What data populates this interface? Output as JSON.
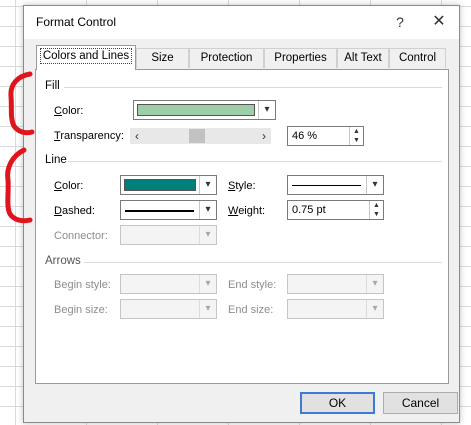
{
  "window": {
    "title": "Format Control",
    "help_glyph": "?",
    "close_glyph": "✕"
  },
  "tabs": [
    {
      "label": "Colors and Lines",
      "active": true
    },
    {
      "label": "Size",
      "active": false
    },
    {
      "label": "Protection",
      "active": false
    },
    {
      "label": "Properties",
      "active": false
    },
    {
      "label": "Alt Text",
      "active": false
    },
    {
      "label": "Control",
      "active": false
    }
  ],
  "fill": {
    "title": "Fill",
    "color_label": "Color:",
    "color_value": "#9ccfa8",
    "transparency_label": "Transparency:",
    "transparency_value": "46 %",
    "transparency_level": 0.46
  },
  "line": {
    "title": "Line",
    "color_label": "Color:",
    "color_value": "#00807a",
    "dashed_label": "Dashed:",
    "connector_label": "Connector:",
    "style_label": "Style:",
    "weight_label": "Weight:",
    "weight_value": "0.75 pt"
  },
  "arrows": {
    "title": "Arrows",
    "begin_style_label": "Begin style:",
    "begin_size_label": "Begin size:",
    "end_style_label": "End style:",
    "end_size_label": "End size:"
  },
  "buttons": {
    "ok": "OK",
    "cancel": "Cancel"
  },
  "colors": {
    "annotation": "#e0141c",
    "default_button_border": "#3a7bd5"
  }
}
